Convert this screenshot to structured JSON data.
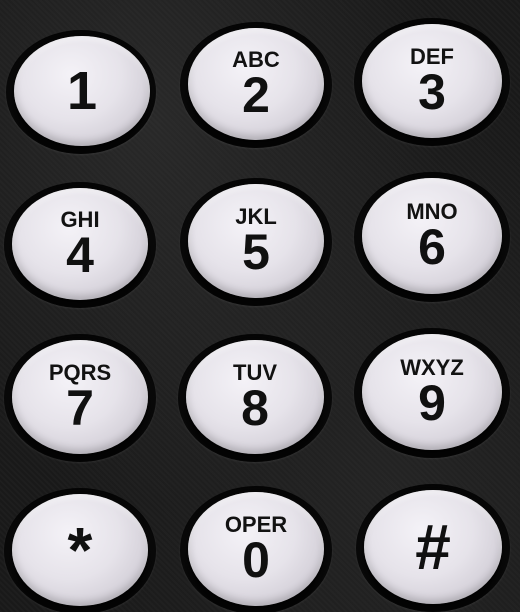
{
  "keys": [
    {
      "digit": "1",
      "letters": ""
    },
    {
      "digit": "2",
      "letters": "ABC"
    },
    {
      "digit": "3",
      "letters": "DEF"
    },
    {
      "digit": "4",
      "letters": "GHI"
    },
    {
      "digit": "5",
      "letters": "JKL"
    },
    {
      "digit": "6",
      "letters": "MNO"
    },
    {
      "digit": "7",
      "letters": "PQRS"
    },
    {
      "digit": "8",
      "letters": "TUV"
    },
    {
      "digit": "9",
      "letters": "WXYZ"
    },
    {
      "digit": "*",
      "letters": ""
    },
    {
      "digit": "0",
      "letters": "OPER"
    },
    {
      "digit": "#",
      "letters": ""
    }
  ],
  "colors": {
    "housing": "#1a1a1a",
    "key_face": "#e6e3ea",
    "key_text": "#121212"
  }
}
